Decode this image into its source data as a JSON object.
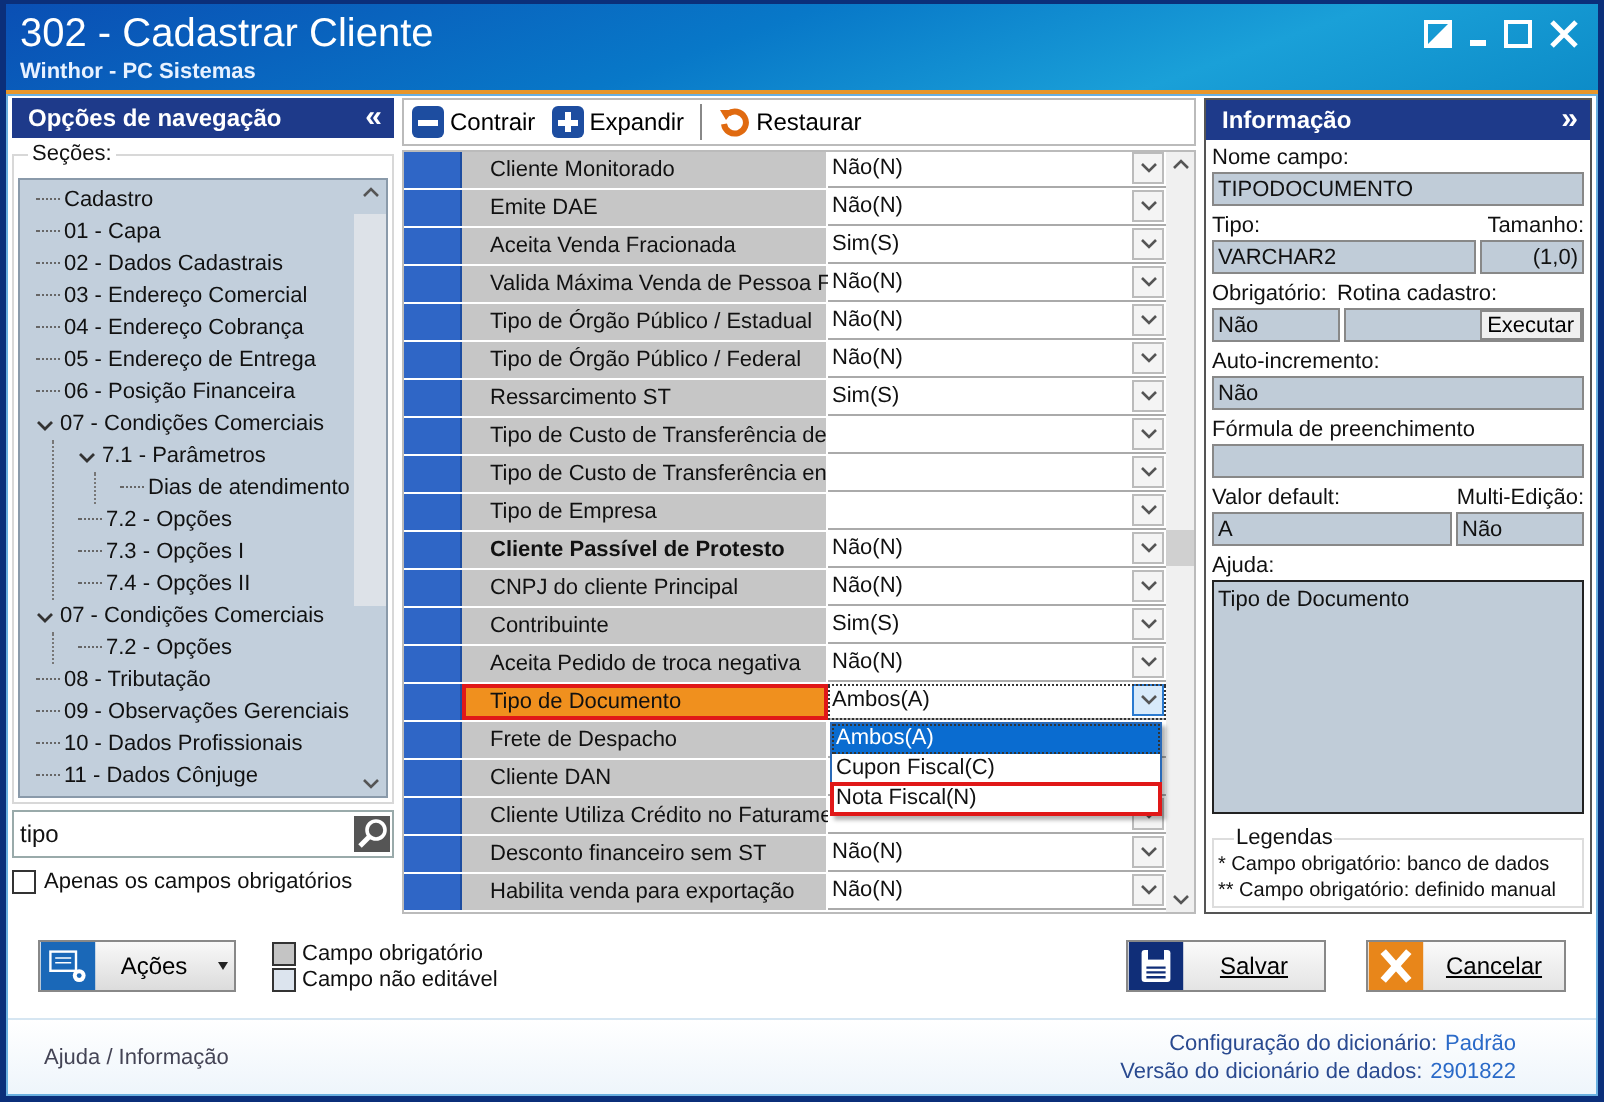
{
  "window": {
    "title": "302 - Cadastrar Cliente",
    "subtitle": "Winthor - PC Sistemas"
  },
  "navigation": {
    "title": "Opções de navegação",
    "collapse": "«",
    "sections_label": "Seções:",
    "tree": [
      {
        "label": "Cadastro"
      },
      {
        "label": "01 - Capa"
      },
      {
        "label": "02 - Dados Cadastrais"
      },
      {
        "label": "03 - Endereço Comercial"
      },
      {
        "label": "04 - Endereço Cobrança"
      },
      {
        "label": "05 - Endereço de Entrega"
      },
      {
        "label": "06 - Posição Financeira"
      },
      {
        "label": "07 - Condições Comerciais",
        "expanded": true,
        "children": [
          {
            "label": "7.1 - Parâmetros",
            "expanded": true,
            "children": [
              {
                "label": "Dias de atendimento"
              }
            ]
          },
          {
            "label": "7.2 - Opções"
          },
          {
            "label": "7.3 - Opções I"
          },
          {
            "label": "7.4 - Opções II"
          }
        ]
      },
      {
        "label": "07 - Condições Comerciais",
        "expanded": true,
        "children": [
          {
            "label": "7.2 - Opções"
          }
        ]
      },
      {
        "label": "08 - Tributação"
      },
      {
        "label": "09 - Observações Gerenciais"
      },
      {
        "label": "10 - Dados Profissionais"
      },
      {
        "label": "11 - Dados Cônjuge"
      }
    ],
    "search": {
      "value": "tipo"
    },
    "only_required": {
      "label": "Apenas os campos obrigatórios",
      "checked": false
    }
  },
  "toolbar": [
    {
      "kind": "minus",
      "label": "Contrair"
    },
    {
      "kind": "plus",
      "label": "Expandir"
    },
    {
      "kind": "restore",
      "label": "Restaurar"
    }
  ],
  "grid": {
    "rows": [
      {
        "label": "Cliente Monitorado",
        "value": "Não(N)",
        "bold": false,
        "selected": false
      },
      {
        "label": "Emite DAE",
        "value": "Não(N)",
        "bold": false,
        "selected": false
      },
      {
        "label": "Aceita Venda Fracionada",
        "value": "Sim(S)",
        "bold": false,
        "selected": false
      },
      {
        "label": "Valida Máxima Venda de Pessoa F",
        "value": "Não(N)",
        "bold": false,
        "selected": false
      },
      {
        "label": "Tipo de Órgão Público / Estadual",
        "value": "Não(N)",
        "bold": false,
        "selected": false
      },
      {
        "label": "Tipo de Órgão Público / Federal",
        "value": "Não(N)",
        "bold": false,
        "selected": false
      },
      {
        "label": "Ressarcimento ST",
        "value": "Sim(S)",
        "bold": false,
        "selected": false
      },
      {
        "label": "Tipo de Custo de Transferência de",
        "bold": false,
        "selected": false
      },
      {
        "label": "Tipo de Custo de Transferência en",
        "bold": false,
        "selected": false
      },
      {
        "label": "Tipo de Empresa",
        "bold": false,
        "selected": false
      },
      {
        "label": "Cliente Passível de Protesto",
        "value": "Não(N)",
        "bold": true,
        "selected": false
      },
      {
        "label": "CNPJ do cliente Principal",
        "value": "Não(N)",
        "bold": false,
        "selected": false
      },
      {
        "label": "Contribuinte",
        "value": "Sim(S)",
        "bold": false,
        "selected": false
      },
      {
        "label": "Aceita Pedido de troca negativa",
        "value": "Não(N)",
        "bold": false,
        "selected": false
      },
      {
        "label": "Tipo de Documento",
        "value": "Ambos(A)",
        "bold": false,
        "selected": true,
        "annotated": true,
        "dropdown": [
          {
            "label": "Ambos(A)",
            "selected": true,
            "annotated": false
          },
          {
            "label": "Cupon Fiscal(C)",
            "selected": false,
            "annotated": false
          },
          {
            "label": "Nota Fiscal(N)",
            "selected": false,
            "annotated": true
          }
        ]
      },
      {
        "label": "Frete de Despacho",
        "bold": false,
        "selected": false
      },
      {
        "label": "Cliente DAN",
        "bold": false,
        "selected": false
      },
      {
        "label": "Cliente Utiliza Crédito no Faturame",
        "bold": false,
        "selected": false
      },
      {
        "label": "Desconto financeiro sem ST",
        "value": "Não(N)",
        "bold": false,
        "selected": false
      },
      {
        "label": "Habilita venda para exportação",
        "value": "Não(N)",
        "bold": false,
        "selected": false
      }
    ]
  },
  "info": {
    "title": "Informação",
    "expand": "»",
    "field_name": {
      "label": "Nome campo:",
      "value": "TIPODOCUMENTO"
    },
    "type": {
      "label": "Tipo:",
      "value": "VARCHAR2"
    },
    "size": {
      "label": "Tamanho:",
      "value": "(1,0)"
    },
    "required": {
      "label": "Obrigatório:",
      "value": "Não"
    },
    "routine": {
      "label": "Rotina cadastro:",
      "button": "Executar"
    },
    "auto_increment": {
      "label": "Auto-incremento:",
      "value": "Não"
    },
    "formula": {
      "label": "Fórmula de preenchimento"
    },
    "default": {
      "label": "Valor default:",
      "value": "A"
    },
    "multi_edit": {
      "label": "Multi-Edição:",
      "value": "Não"
    },
    "help": {
      "label": "Ajuda:",
      "value": "Tipo de Documento"
    },
    "legend": {
      "title": "Legendas",
      "lines": [
        "* Campo obrigatório: banco de dados",
        "** Campo obrigatório: definido manual"
      ]
    }
  },
  "actions": {
    "label": "Ações"
  },
  "legend": [
    {
      "kind": "required",
      "label": "Campo obrigatório"
    },
    {
      "kind": "readonly",
      "label": "Campo não editável"
    }
  ],
  "buttons": [
    {
      "kind": "save",
      "label": "Salvar"
    },
    {
      "kind": "cancel",
      "label": "Cancelar"
    }
  ],
  "footer": {
    "help_link": "Ajuda / Informação",
    "lines": [
      {
        "label": "Configuração do dicionário:",
        "value": "Padrão"
      },
      {
        "label": "Versão do dicionário de dados:",
        "value": "2901822"
      }
    ]
  }
}
